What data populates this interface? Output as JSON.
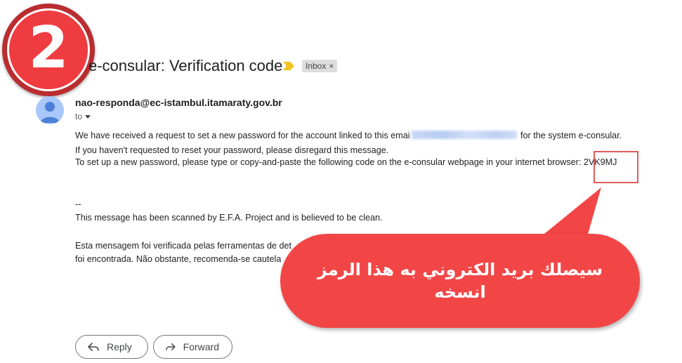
{
  "step_badge": {
    "number": "2"
  },
  "email": {
    "subject": "e-consular: Verification code",
    "label_chip": {
      "label": "Inbox",
      "close_glyph": "×"
    },
    "sender": "nao-responda@ec-istambul.itamaraty.gov.br",
    "to_label": "to",
    "body": {
      "line1_before": "We have received a request to set a new password for the account linked to this emai",
      "line1_after": " for the system e-consular.",
      "line2": "If you haven't requested to reset your password, please disregard this message.",
      "line3_prefix": "To set up a new password, please type or copy-and-paste the following code on the e-consular webpage in your internet browser: ",
      "code": "2VK9MJ",
      "signature_sep": "--",
      "scan_notice": "This message has been scanned by E.F.A. Project and is believed to be clean.",
      "pt_line1": "Esta mensagem foi verificada pelas ferramentas de det",
      "pt_line2": "foi encontrada. Não obstante, recomenda-se cautela"
    }
  },
  "callout": {
    "line1": "سيصلك بريد الكتروني به هذا الرمز",
    "line2": "انسخه",
    "color": "#f24646"
  },
  "actions": {
    "reply_label": "Reply",
    "forward_label": "Forward"
  },
  "icons": {
    "important": "important-marker-icon",
    "avatar": "person-avatar-icon",
    "reply": "reply-arrow-icon",
    "forward": "forward-arrow-icon"
  },
  "colors": {
    "badge": "#ee3c40",
    "highlight_box": "#e05a5a",
    "important": "#f2c21c"
  }
}
